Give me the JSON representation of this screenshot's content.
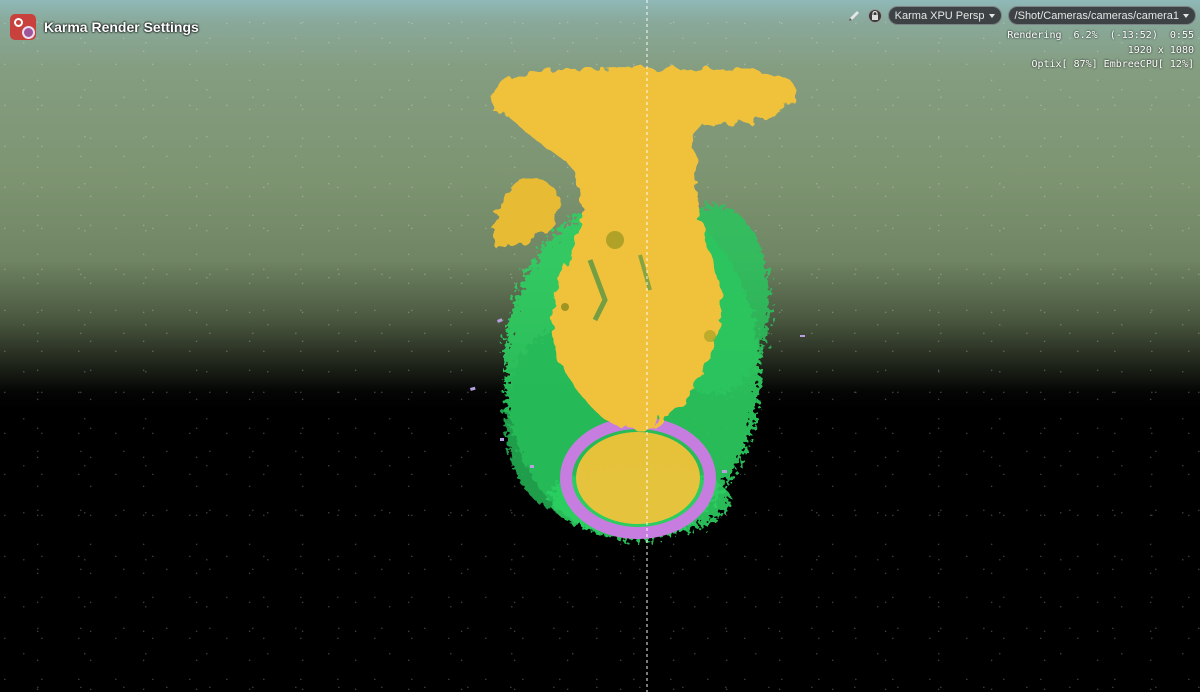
{
  "window": {
    "title": "Karma Render Settings"
  },
  "toolbar": {
    "icons": [
      "pencil-icon",
      "lock-icon"
    ],
    "renderer_label": "Karma XPU Persp",
    "camera_path": "/Shot/Cameras/cameras/camera1"
  },
  "render_stats": {
    "status": "Rendering",
    "progress_percent": "6.2%",
    "time_remaining": "(-13:52)",
    "elapsed": "0:55",
    "resolution": "1920 x 1080",
    "devices": "Optix[ 87%] EmbreeCPU[ 12%]"
  },
  "colors": {
    "sky_top": "#8fb8b7",
    "sky_mid": "#7d9471",
    "ground": "#000000",
    "fluid_yellow": "#f0c23a",
    "particles_green": "#2ecf63",
    "ring_purple": "#c77de0"
  }
}
